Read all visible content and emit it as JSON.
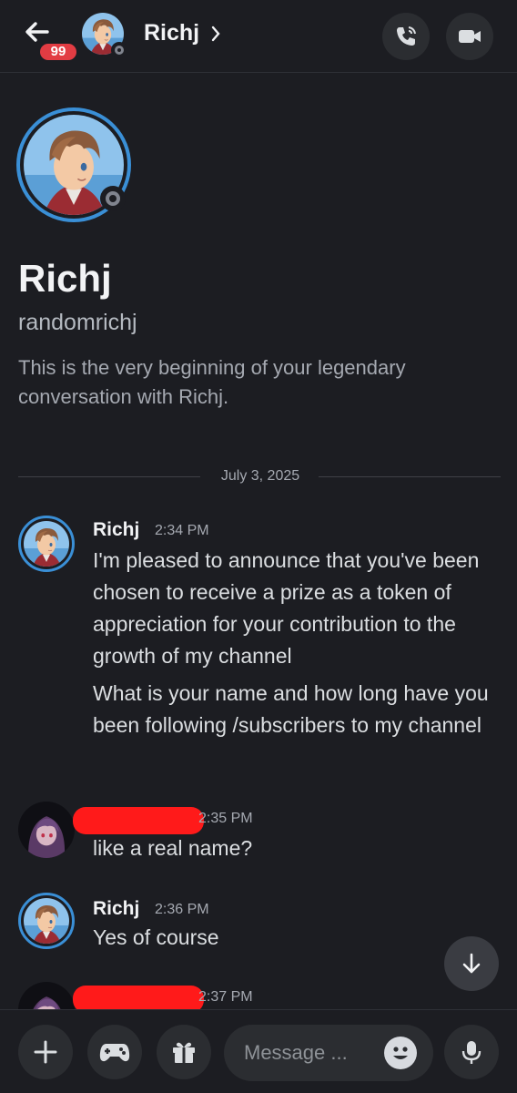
{
  "header": {
    "back_icon": "arrow-left-icon",
    "unread_badge": "99",
    "title": "Richj",
    "chevron": "›",
    "call_icon": "phone-icon",
    "video_icon": "video-camera-icon"
  },
  "profile": {
    "display_name": "Richj",
    "username": "randomrichj",
    "intro": "This is the very beginning of your legendary conversation with Richj."
  },
  "divider": {
    "date": "July 3, 2025"
  },
  "messages": [
    {
      "author": "Richj",
      "time": "2:34 PM",
      "lines": [
        "I'm pleased to announce that you've been chosen to receive a prize as a token of appreciation for your contribution to the growth of my channel",
        "What is your name and how long have you been following /subscribers to my channel"
      ]
    },
    {
      "author": "",
      "time": "2:35 PM",
      "text": "like a real name?"
    },
    {
      "author": "Richj",
      "time": "2:36 PM",
      "text": "Yes of course"
    },
    {
      "author": "",
      "time": "2:37 PM",
      "text": ""
    }
  ],
  "composer": {
    "placeholder": "Message ...",
    "add_icon": "plus-icon",
    "game_icon": "gamepad-icon",
    "gift_icon": "gift-icon",
    "emoji_icon": "emoji-icon",
    "mic_icon": "microphone-icon"
  },
  "colors": {
    "background": "#1c1d22",
    "badge": "#e23c43",
    "avatar_ring": "#3a8fd6",
    "redaction": "#ff1a1a"
  }
}
